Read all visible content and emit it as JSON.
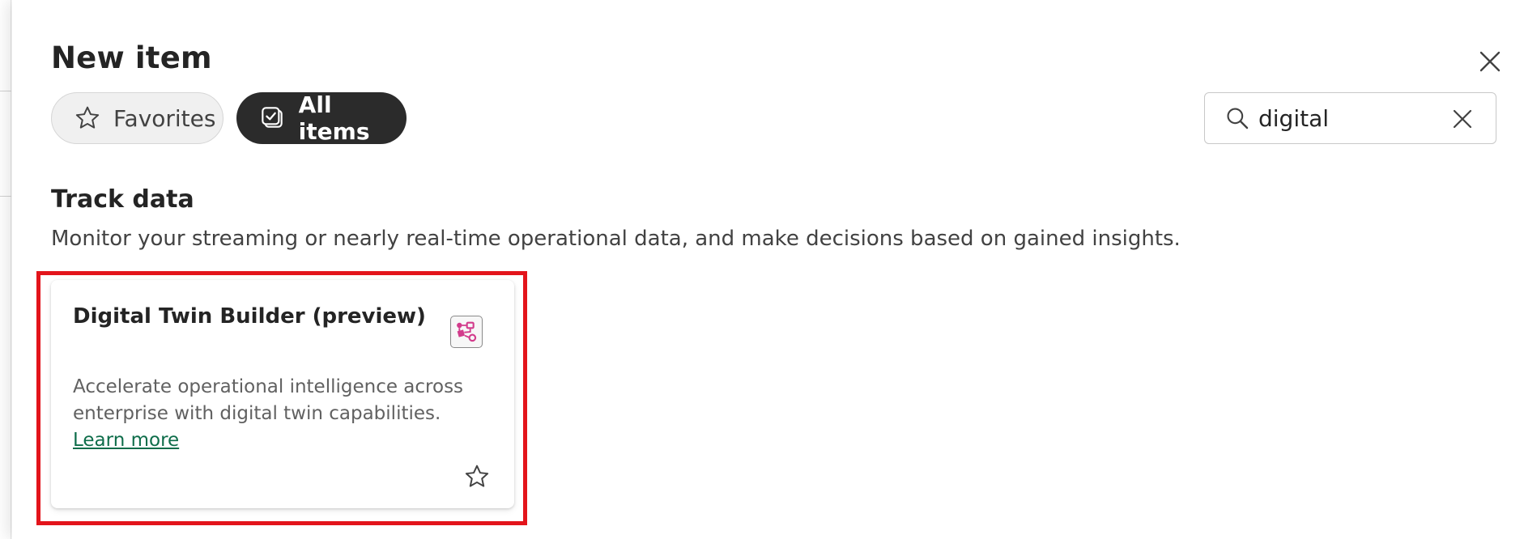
{
  "dialog": {
    "title": "New item"
  },
  "filters": {
    "favorites_label": "Favorites",
    "all_items_label": "All items",
    "selected": "All items"
  },
  "search": {
    "value": "digital"
  },
  "section": {
    "title": "Track data",
    "description": "Monitor your streaming or nearly real-time operational data, and make decisions based on gained insights."
  },
  "items": [
    {
      "title": "Digital Twin Builder (preview)",
      "description": "Accelerate operational intelligence across enterprise with digital twin capabilities.",
      "link_text": "Learn more",
      "icon": "digital-twin-builder-icon",
      "favorited": false
    }
  ],
  "colors": {
    "highlight_border": "#e3141b",
    "selected_pill_bg": "#2b2b2b",
    "link": "#0e6d4a",
    "item_icon_accent": "#d23c8c"
  }
}
